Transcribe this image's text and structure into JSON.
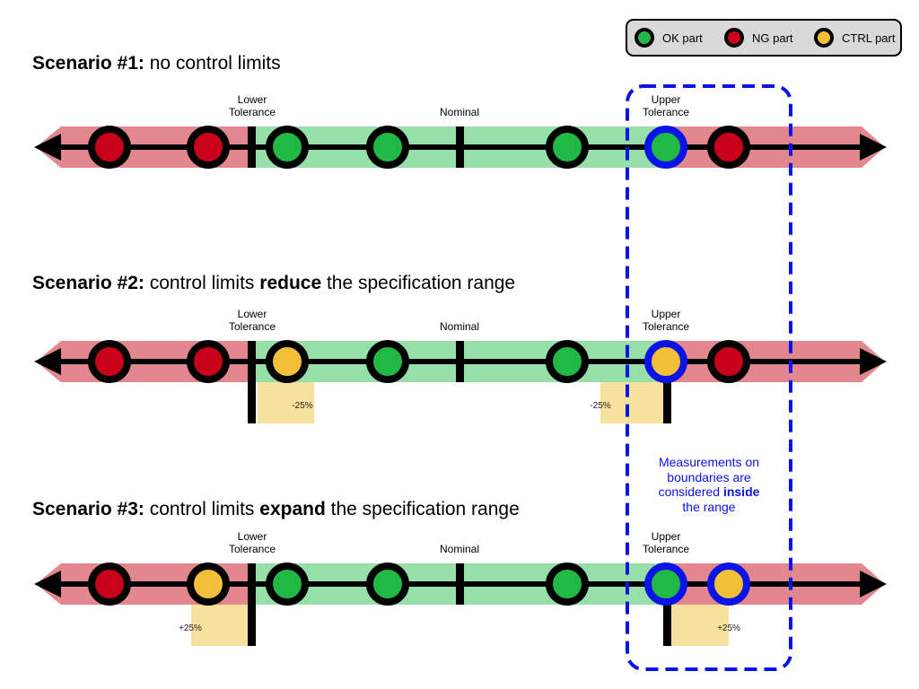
{
  "legend": {
    "items": [
      {
        "label": "OK part",
        "color": "#22b845"
      },
      {
        "label": "NG part",
        "color": "#c8001a"
      },
      {
        "label": "CTRL part",
        "color": "#f2c038"
      }
    ]
  },
  "colors": {
    "ok": "#22b845",
    "ng": "#c8001a",
    "ctrl": "#f2c038",
    "band_red": "#e3878f",
    "band_green": "#96dfa8",
    "control_zone": "#f8e19c",
    "boundary": "#0a14e6"
  },
  "labels": {
    "lower1": "Lower",
    "lower2": "Tolerance",
    "upper1": "Upper",
    "upper2": "Tolerance",
    "nominal": "Nominal"
  },
  "scenarios": [
    {
      "title_bold": "Scenario #1:",
      "title_parts": [
        {
          "t": " no control limits",
          "b": false
        }
      ],
      "dots": [
        "ng",
        "ng",
        "ok",
        "ok",
        "ok",
        "ok",
        "ng"
      ],
      "boundary": [
        5
      ],
      "control": null
    },
    {
      "title_bold": "Scenario #2:",
      "title_parts": [
        {
          "t": " control limits ",
          "b": false
        },
        {
          "t": "reduce",
          "b": true
        },
        {
          "t": " the specification range",
          "b": false
        }
      ],
      "dots": [
        "ng",
        "ng",
        "ctrl",
        "ok",
        "ok",
        "ctrl",
        "ng"
      ],
      "boundary": [
        5
      ],
      "control": {
        "type": "reduce",
        "lower_label": "-25%",
        "upper_label": "-25%"
      }
    },
    {
      "title_bold": "Scenario #3:",
      "title_parts": [
        {
          "t": " control limits ",
          "b": false
        },
        {
          "t": "expand",
          "b": true
        },
        {
          "t": " the specification range",
          "b": false
        }
      ],
      "dots": [
        "ng",
        "ctrl",
        "ok",
        "ok",
        "ok",
        "ok",
        "ctrl"
      ],
      "boundary": [
        5,
        6
      ],
      "control": {
        "type": "expand",
        "lower_label": "+25%",
        "upper_label": "+25%"
      }
    }
  ],
  "note": {
    "line1": "Measurements on",
    "line2": "boundaries are",
    "line3_a": "considered ",
    "line3_b": "inside",
    "line4": "the range"
  }
}
